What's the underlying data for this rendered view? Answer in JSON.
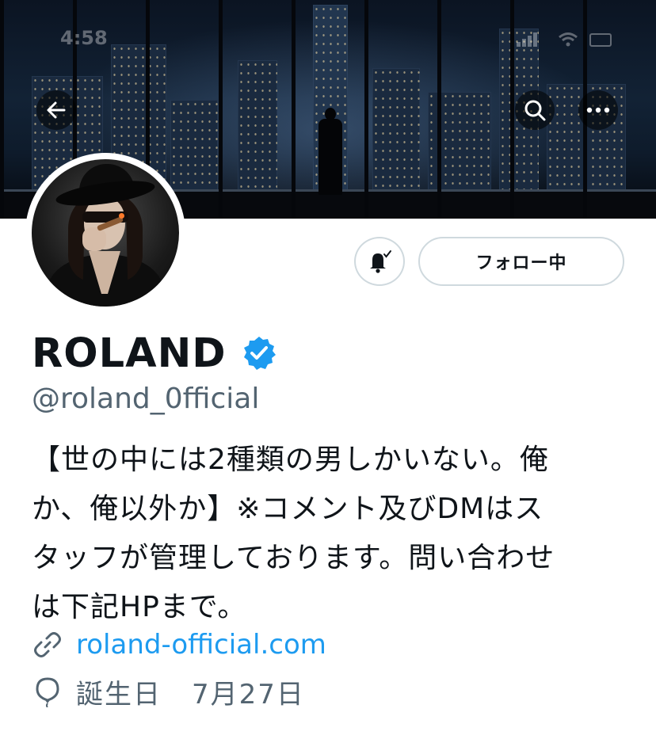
{
  "status_bar": {
    "time": "4:58"
  },
  "header": {
    "back_icon": "arrow-left-icon",
    "search_icon": "search-icon",
    "more_icon": "more-horizontal-icon"
  },
  "profile": {
    "display_name": "ROLAND",
    "verified_icon": "verified-badge-icon",
    "handle": "@roland_0fficial",
    "bio_lines": [
      "【世の中には2種類の男しかいない。俺",
      "か、俺以外か】※コメント及びDMはス",
      "タッフが管理しております。問い合わせ",
      "は下記HPまで。"
    ],
    "website": "roland-official.com",
    "birthday_label": "誕生日",
    "birthday_value": "7月27日"
  },
  "actions": {
    "notify_icon": "bell-check-icon",
    "follow_label": "フォロー中"
  },
  "colors": {
    "accent": "#1d9bf0",
    "verified": "#1d9bf0",
    "text_primary": "#0f1419",
    "text_secondary": "#536471",
    "border": "#cfd9de"
  }
}
